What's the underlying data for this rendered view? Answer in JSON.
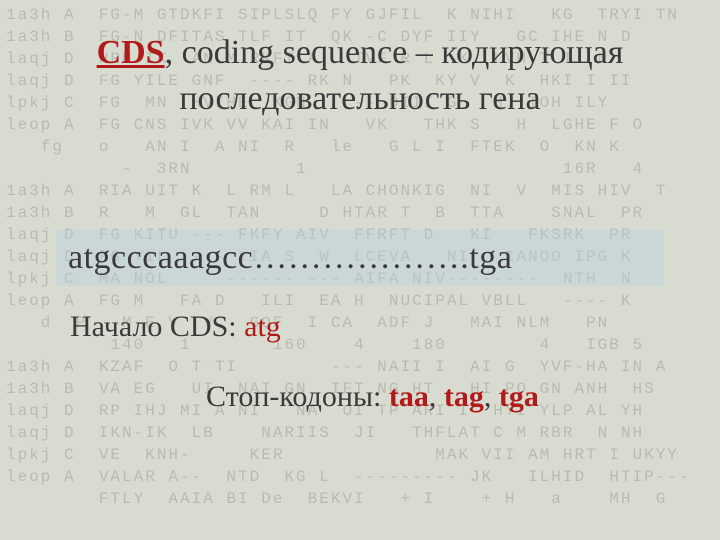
{
  "title": {
    "abbr": "CDS",
    "rest": ", coding sequence – кодирующая последовательность гена"
  },
  "sequence_display": "atgcccaaagcc……………….tga",
  "start_line": {
    "label": "Начало CDS:  ",
    "codon": "atg"
  },
  "stop_line": {
    "label": "Стоп-кодоны: ",
    "codon1": "taa",
    "codon2": "tag",
    "codon3": "tga",
    "sep": ", "
  },
  "bg_noise": "1a3h A  FG-M GTDKFI SIPLSLQ FY GJFIL  K NIHI   KG  TRYI TN\n1a3h B  FG-N DFITAS TLF IT  QK -C DYF IIY   GC IHE N D\nlaqj D  HRN IK  AN M RKFT A   TVF R L  K  LVH T I  N\nlaqj D  FG YILE GNF  ---- RK N   PK  KY V  K  HKI I II\nlpkj C  FG  MN  HVIHE  KGN    -- DIII G   H. TOH ILY\nleop A  FG CNS IVK VV KAI IN   VK   THK S   H  LGHE F O\n   fg   o   AN I  A NI  R   le   G L I  FTEK  O  KN K\n          -  3RN         1                      16R   4\n1a3h A  RIA UIT K  L RM L   LA CHONKIG  NI  V  MIS HIV  T\n1a3h B  R   M  GL  TAN     D HTAR T  B  TTA    SNAL  PR\nlaqj D  FG KITU --- FKFY AIV  FFRFT D   KI   FKSRK  PR\nlaqj D  FG YIL  --- YIA S  W  LCEVA   NI   IANOD IPG K\nlpkj C  MA NOL     ------ --- AIFA NIV--------  NTH  N\nleop A  FG M   FA D   ILI  EA H  NUCIPAL VBLL   ---- K\n   d  P   M E V  V   GQF  I CA  ADF J   MAI NLM   PN\n         140   1       160    4    180        4   IGB 5\n1a3h A  KZAF  O T TI        --- NAII I  AI G  YVF-HA IN A\n1a3h B  VA EG   UI  NAI GN  IFT NG HT   HI PO GN ANH  HS\nlaqj D  RP IHJ MI A NI   NA  OI TP ARI I  HYI YLP AL YH\nlaqj D  IKN-IK  LB    NARIIS  JI   THFLAT C M RBR  N NH\nlpkj C  VE  KNH-     KER             MAK VII AM HRT I UKYY\nleop A  VALAR A--  NTD  KG L  --------- JK   ILHID  HTIP---\n        FTLY  AAIA BI De  BEKVI   + I    + H   a    MH  G"
}
